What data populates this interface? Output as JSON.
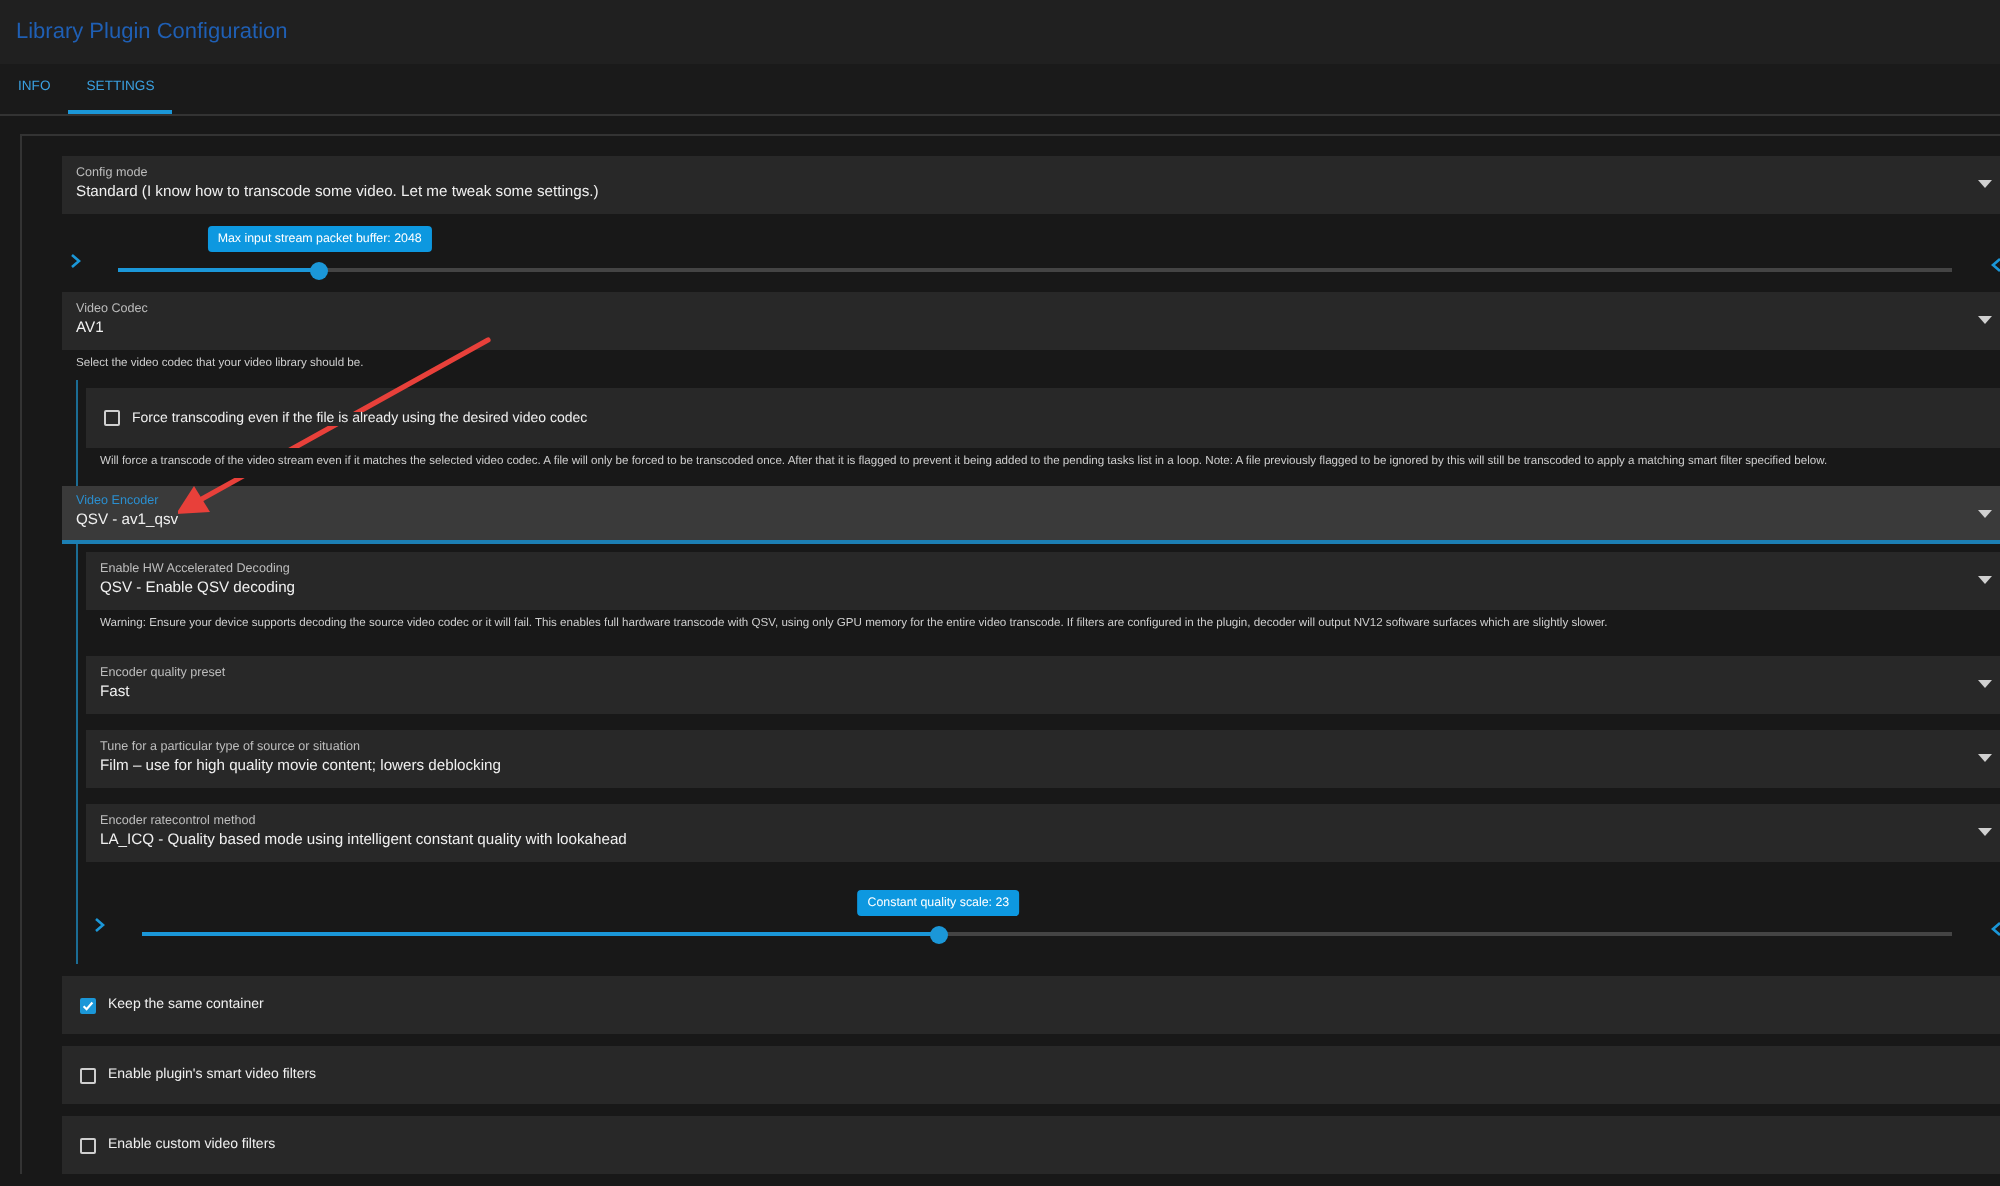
{
  "title": "Library Plugin Configuration",
  "tabs": [
    {
      "label": "INFO",
      "selected": false
    },
    {
      "label": "SETTINGS",
      "selected": true
    }
  ],
  "fields": [
    {
      "kind": "select",
      "label": "Config mode",
      "value": "Standard (I know how to transcode some video. Let me tweak some settings.)",
      "focused": false
    },
    {
      "kind": "slider",
      "tooltip": "Max input stream packet buffer: 2048",
      "level": 0.11
    },
    {
      "kind": "select",
      "label": "Video Codec",
      "value": "AV1",
      "focused": false
    },
    {
      "kind": "note",
      "text": "Select the video codec that your video library should be."
    },
    {
      "kind": "group",
      "children": [
        {
          "kind": "checkbox",
          "label": "Force transcoding even if the file is already using the desired video codec",
          "checked": false
        },
        {
          "kind": "note",
          "text": "Will force a transcode of the video stream even if it matches the selected video codec. A file will only be forced to be transcoded once. After that it is flagged to prevent it being added to the pending tasks list in a loop. Note: A file previously flagged to be ignored by this will still be transcoded to apply a matching smart filter specified below."
        }
      ]
    },
    {
      "kind": "select",
      "label": "Video Encoder",
      "value": "QSV - av1_qsv",
      "focused": true
    },
    {
      "kind": "group",
      "children": [
        {
          "kind": "select",
          "label": "Enable HW Accelerated Decoding",
          "value": "QSV - Enable QSV decoding",
          "focused": false
        },
        {
          "kind": "note",
          "text": "Warning: Ensure your device supports decoding the source video codec or it will fail. This enables full hardware transcode with QSV, using only GPU memory for the entire video transcode. If filters are configured in the plugin, decoder will output NV12 software surfaces which are slightly slower."
        },
        {
          "kind": "select",
          "label": "Encoder quality preset",
          "value": "Fast",
          "focused": false
        },
        {
          "kind": "select",
          "label": "Tune for a particular type of source or situation",
          "value": "Film – use for high quality movie content; lowers deblocking",
          "focused": false
        },
        {
          "kind": "select",
          "label": "Encoder ratecontrol method",
          "value": "LA_ICQ - Quality based mode using intelligent constant quality with lookahead",
          "focused": false
        },
        {
          "kind": "slider",
          "tooltip": "Constant quality scale: 23",
          "level": 0.44
        }
      ]
    },
    {
      "kind": "checkbox",
      "label": "Keep the same container",
      "checked": true
    },
    {
      "kind": "checkbox",
      "label": "Enable plugin's smart video filters",
      "checked": false
    },
    {
      "kind": "checkbox",
      "label": "Enable custom video filters",
      "checked": false
    }
  ]
}
